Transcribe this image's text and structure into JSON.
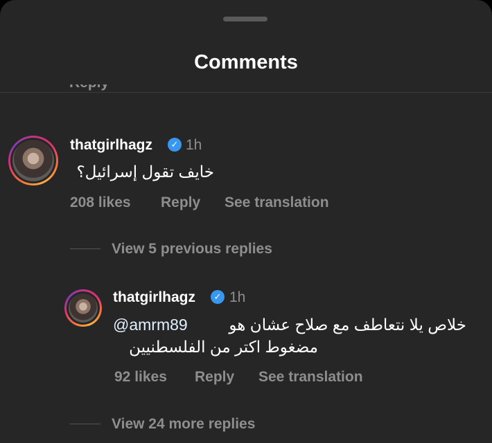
{
  "header": {
    "title": "Comments",
    "clipped_label": "Reply"
  },
  "comment": {
    "username": "thatgirlhagz",
    "time": "1h",
    "text": "خايف تقول إسرائيل؟",
    "likes": "208 likes",
    "reply_label": "Reply",
    "translate_label": "See translation",
    "view_previous": "View 5 previous replies"
  },
  "reply": {
    "username": "thatgirlhagz",
    "time": "1h",
    "mention": "@amrm89",
    "text_line1": "خلاص يلا نتعاطف مع صلاح عشان هو",
    "text_line2": "مضغوط اكتر من الفلسطنيين",
    "likes": "92 likes",
    "reply_label": "Reply",
    "translate_label": "See translation",
    "view_more": "View 24 more replies"
  },
  "icons": {
    "verified": "verified-badge-icon",
    "grab": "grab-handle"
  },
  "colors": {
    "background": "#262626",
    "muted": "#8e8e8e",
    "verified": "#3897f0",
    "text": "#ffffff"
  }
}
